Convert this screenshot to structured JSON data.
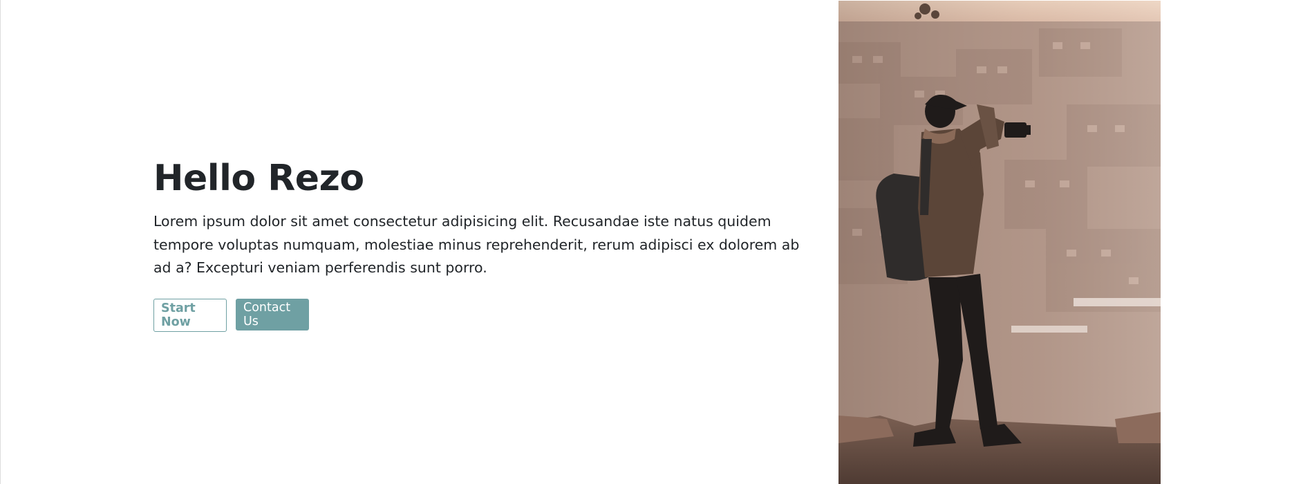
{
  "hero": {
    "title": "Hello Rezo",
    "body": "Lorem ipsum dolor sit amet consectetur adipisicing elit. Recusandae iste natus quidem tempore voluptas numquam, molestiae minus reprehenderit, rerum adipisci ex dolorem ab ad a? Excepturi veniam perferendis sunt porro.",
    "start_button": "Start Now",
    "contact_button": "Contact Us"
  },
  "colors": {
    "accent": "#6fa0a3",
    "text": "#212529",
    "background": "#ffffff"
  },
  "image": {
    "subject": "photographer-with-camera-and-backpack"
  }
}
